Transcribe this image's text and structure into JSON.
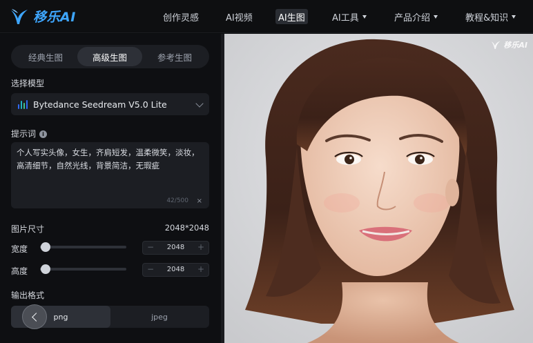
{
  "header": {
    "brand": "移乐AI",
    "nav": [
      {
        "label": "创作灵感",
        "has_caret": false
      },
      {
        "label": "AI视频",
        "has_caret": false
      },
      {
        "label": "AI生图",
        "has_caret": false,
        "active": true
      },
      {
        "label": "AI工具",
        "has_caret": true
      },
      {
        "label": "产品介绍",
        "has_caret": true
      },
      {
        "label": "教程&知识",
        "has_caret": true
      }
    ]
  },
  "panel": {
    "tabs": [
      "经典生图",
      "高级生图",
      "参考生图"
    ],
    "active_tab": "高级生图",
    "model_label": "选择模型",
    "model_value": "Bytedance Seedream V5.0 Lite",
    "prompt_label": "提示词",
    "prompt_text": "个人写实头像，女生，齐肩短发，温柔微笑，淡妆，高清细节，自然光线，背景简洁，无瑕疵",
    "prompt_counter": "42/500",
    "prompt_clear": "×",
    "size_label": "图片尺寸",
    "size_value": "2048*2048",
    "width_label": "宽度",
    "width_value": "2048",
    "width_slider_fraction": 0.06,
    "height_label": "高度",
    "height_value": "2048",
    "height_slider_fraction": 0.06,
    "stepper_minus": "−",
    "stepper_plus": "+",
    "format_label": "输出格式",
    "formats": [
      "png",
      "jpeg"
    ],
    "active_format": "png"
  },
  "image": {
    "watermark": "移乐AI"
  },
  "colors": {
    "brand_blue": "#3ea6ff",
    "model_icon": [
      "#2f6cf6",
      "#22b3c7",
      "#41c58f",
      "#2f6cf6"
    ]
  }
}
